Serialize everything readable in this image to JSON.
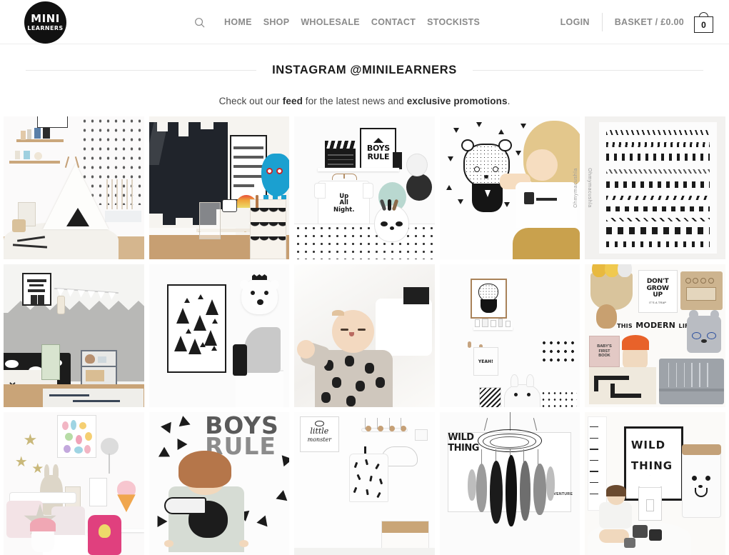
{
  "header": {
    "logo": {
      "line1": "MINI",
      "line2": "LEARNERS",
      "name": "mini-learners-logo"
    },
    "search_icon": "search-icon",
    "nav": [
      {
        "label": "HOME"
      },
      {
        "label": "SHOP"
      },
      {
        "label": "WHOLESALE"
      },
      {
        "label": "CONTACT"
      },
      {
        "label": "STOCKISTS"
      }
    ],
    "login_label": "LOGIN",
    "basket_label": "BASKET / £0.00",
    "basket_count": "0",
    "basket_icon": "shopping-bag-icon"
  },
  "page": {
    "title": "INSTAGRAM @MINILEARNERS",
    "subtitle": {
      "part1": "Check out our ",
      "bold1": "feed",
      "part2": " for the latest news and ",
      "bold2": "exclusive promotions",
      "part3": "."
    }
  },
  "colors": {
    "accent": "#111111",
    "nav_text": "#8a8a8a",
    "title_text": "#1a1a1a",
    "rule": "#e8e8e8",
    "background": "#ffffff"
  },
  "gallery": {
    "columns": 5,
    "rows": 3,
    "posts": [
      {
        "id": 1,
        "alt": "White nursery with canvas teepee, star-patterned wall, picture ledges and wooden cot"
      },
      {
        "id": 2,
        "alt": "Playroom with black chalkboard wall, alphabet print, kids desk and blue octopus toy"
      },
      {
        "id": 3,
        "alt": "Shelf with BOYS RULE print and clapperboard, Up All Night tee on hanger, panda cushion",
        "texts": {
          "poster": "BOYS\nRULE",
          "tee": "Up\nAll\nNight."
        }
      },
      {
        "id": 4,
        "alt": "Blonde toddler touching a monochrome bear wall decal with triangle confetti",
        "watermark": "Ohmymacushla"
      },
      {
        "id": 5,
        "alt": "Wall sheet of black hand-drawn pattern rows: chevrons, drops, diamonds, triangles",
        "watermark": "Ohmymacushla"
      },
      {
        "id": 6,
        "alt": "Kids bedroom with grey mountain mural, Reach for the Stars poster, bed and trolley"
      },
      {
        "id": 7,
        "alt": "Monochrome pine-tree art print leaning on wall beside a white polar bear head with crown"
      },
      {
        "id": 8,
        "alt": "Laughing baby lying on white bedding wearing a bear-print outfit"
      },
      {
        "id": 9,
        "alt": "White wall with framed fox print, picture ledge, hooks and a YEAH! storage bag",
        "texts": {
          "bag": "YEAH!"
        }
      },
      {
        "id": 10,
        "alt": "Product collage: seagrass basket, DON'T GROW UP print, cardboard oven, bear cushion, grey cot, road play mat",
        "texts": {
          "poster": "DON'T\nGROW\nUP",
          "brand1": "THIS",
          "brand2": "MODERN",
          "brand3": "LIFE",
          "book": "BABY'S\nFIRST\nBOOK"
        }
      },
      {
        "id": 11,
        "alt": "Pastel girls room with gold star decals, ice-cream poster, pink backpack and soft toys"
      },
      {
        "id": 12,
        "alt": "Toddler boy in toucan sweatshirt in front of BOYS RULE wall letters and triangle decals",
        "texts": {
          "wall1": "BOYS",
          "wall2": "RULE"
        }
      },
      {
        "id": 13,
        "alt": "little monster print above a peg rail with a printed drawstring bag and paper storage box",
        "texts": {
          "print1": "little",
          "print2": "monster"
        }
      },
      {
        "id": 14,
        "alt": "Black and white feather dreamcatcher mobile hanging in front of a WILD THING print",
        "texts": {
          "poster1": "WILD",
          "poster2": "THING",
          "poster3": "ADVENTURE"
        }
      },
      {
        "id": 15,
        "alt": "Child playing on a sheepskin rug beside a framed WILD THING print and bear-face paper sack",
        "texts": {
          "poster1": "WILD",
          "poster2": "THING"
        }
      }
    ]
  }
}
